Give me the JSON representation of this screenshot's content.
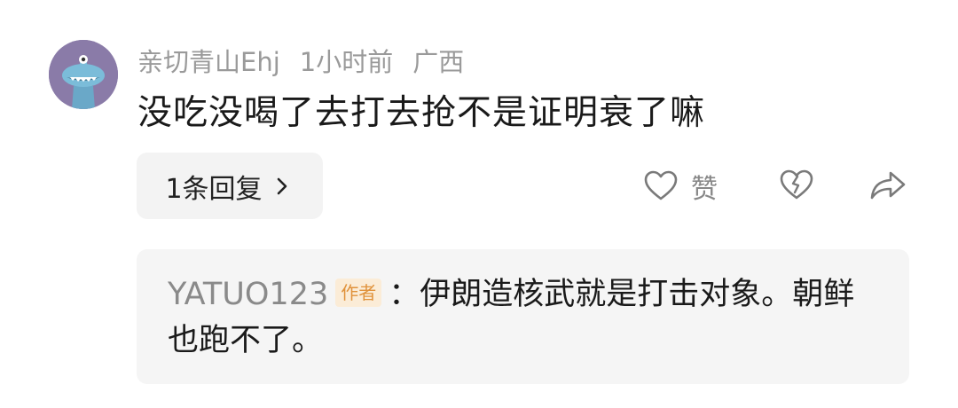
{
  "comment": {
    "username": "亲切青山Ehj",
    "time": "1小时前",
    "location": "广西",
    "text": "没吃没喝了去打去抢不是证明衰了嘛",
    "avatar_icon": "dinosaur-avatar-icon"
  },
  "actions": {
    "reply_count_label": "1条回复",
    "like_label": "赞",
    "like_icon": "heart-icon",
    "dislike_icon": "broken-heart-icon",
    "share_icon": "share-arrow-icon",
    "chevron_icon": "chevron-right-icon"
  },
  "reply": {
    "username": "YATUO123",
    "badge": "作者",
    "separator": "：",
    "text": "伊朗造核武就是打击对象。朝鲜也跑不了。"
  },
  "colors": {
    "avatar_bg": "#8a7ba8",
    "badge_text": "#e0923b",
    "badge_bg": "#fbecd7",
    "muted": "#9a9a9a"
  }
}
